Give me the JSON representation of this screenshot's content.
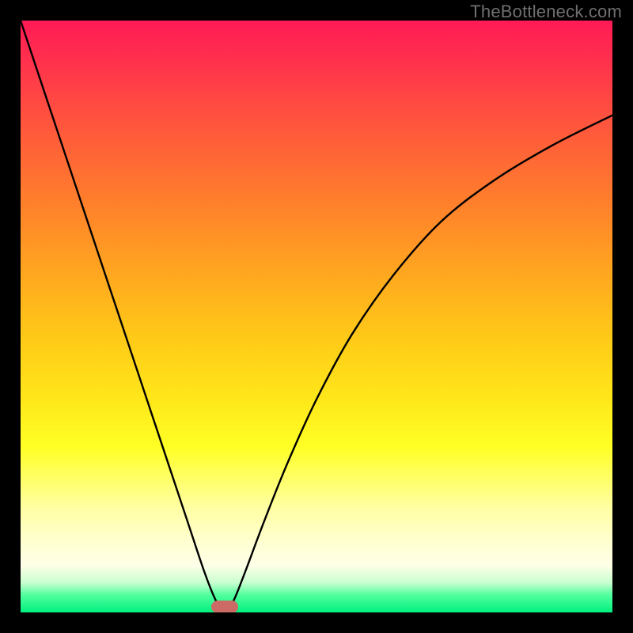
{
  "watermark": "TheBottleneck.com",
  "colors": {
    "frame": "#000000",
    "curve": "#000000",
    "marker": "#cc6a65",
    "gradient_top": "#ff1a55",
    "gradient_bottom": "#00f080"
  },
  "chart_data": {
    "type": "line",
    "title": "",
    "xlabel": "",
    "ylabel": "",
    "xlim": [
      0,
      100
    ],
    "ylim": [
      0,
      100
    ],
    "annotations": [
      {
        "name": "optimal-marker",
        "x": 34.5,
        "y": 1.0
      },
      {
        "name": "watermark",
        "text": "TheBottleneck.com",
        "position": "top-right"
      }
    ],
    "series": [
      {
        "name": "bottleneck-curve",
        "x": [
          0,
          4,
          8,
          12,
          16,
          20,
          24,
          28,
          31,
          33,
          34.5,
          36,
          38,
          41,
          45,
          50,
          56,
          63,
          71,
          80,
          90,
          100
        ],
        "values": [
          100,
          88,
          76,
          64,
          52,
          40,
          28,
          16,
          7,
          2,
          0,
          2,
          7,
          15,
          25,
          36,
          47,
          57,
          66,
          73,
          79,
          84
        ]
      }
    ],
    "background": {
      "type": "vertical-gradient",
      "meaning": "red=high bottleneck, green=optimal",
      "stops": [
        {
          "pos": 1.0,
          "color": "#ff1a55"
        },
        {
          "pos": 0.28,
          "color": "#ffff25"
        },
        {
          "pos": 0.0,
          "color": "#00f080"
        }
      ]
    }
  }
}
